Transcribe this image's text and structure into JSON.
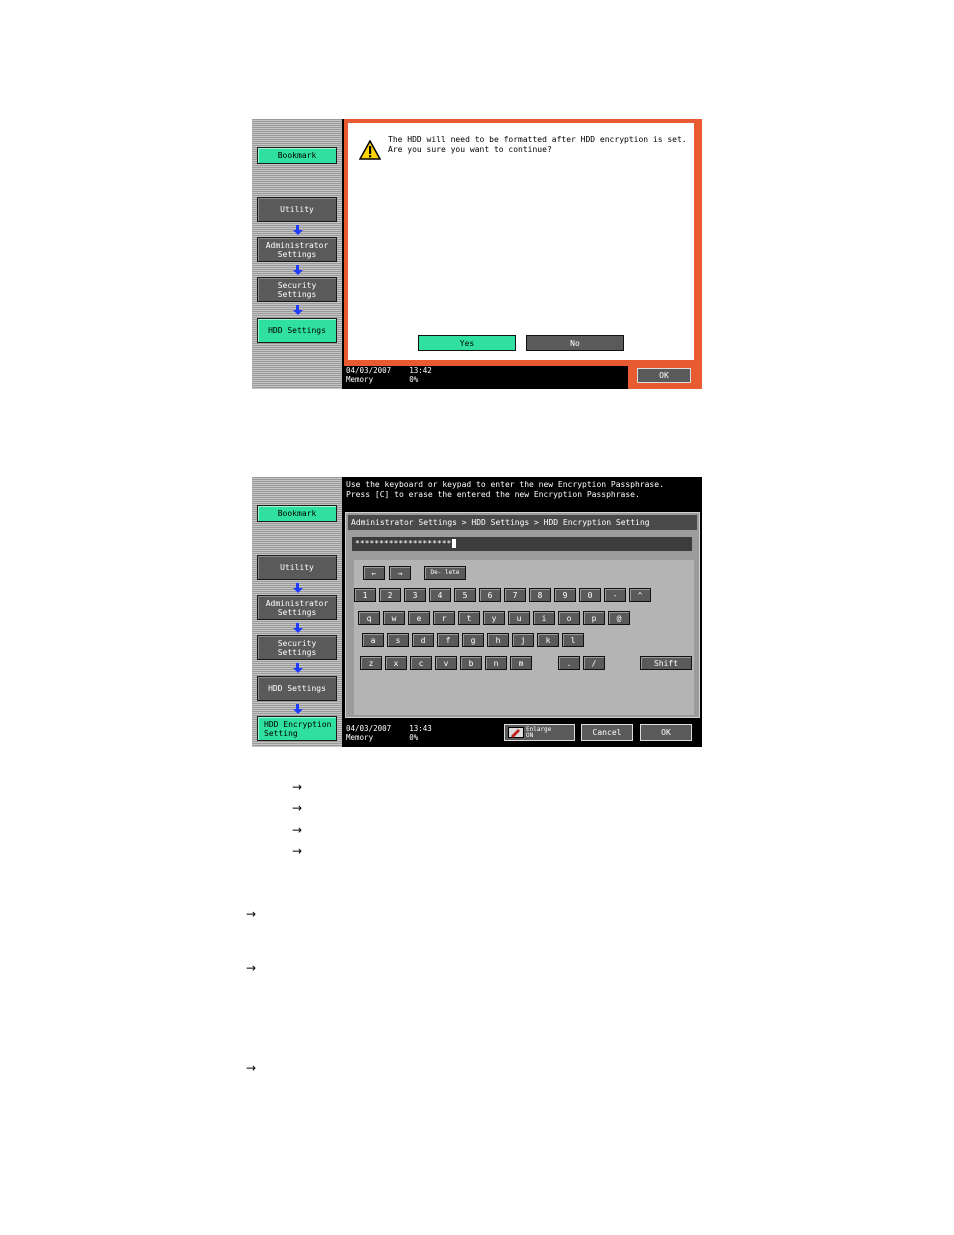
{
  "sidebar": {
    "bookmark": "Bookmark",
    "utility": "Utility",
    "administrator_settings": "Administrator Settings",
    "security_settings": "Security Settings",
    "hdd_settings": "HDD Settings",
    "hdd_encryption_setting": "HDD Encryption Setting"
  },
  "screen1": {
    "message_line1": "The HDD will need to be formatted after HDD encryption is set.",
    "message_line2": "Are you sure you want to continue?",
    "yes": "Yes",
    "no": "No",
    "ok": "OK",
    "status_date": "04/03/2007",
    "status_time": "13:42",
    "status_memory": "Memory",
    "status_percent": "0%"
  },
  "screen2": {
    "prompt_line1": "Use the keyboard or keypad to enter the new Encryption Passphrase.",
    "prompt_line2": "Press [C] to erase the entered the new Encryption Passphrase.",
    "breadcrumb": "Administrator Settings > HDD Settings > HDD Encryption Setting",
    "passphrase_value": "********************",
    "keys": {
      "left": "←",
      "right": "→",
      "delete": "De- lete",
      "row1": [
        "1",
        "2",
        "3",
        "4",
        "5",
        "6",
        "7",
        "8",
        "9",
        "0",
        "-",
        "^"
      ],
      "row2": [
        "q",
        "w",
        "e",
        "r",
        "t",
        "y",
        "u",
        "i",
        "o",
        "p",
        "@"
      ],
      "row3": [
        "a",
        "s",
        "d",
        "f",
        "g",
        "h",
        "j",
        "k",
        "l"
      ],
      "row4": [
        "z",
        "x",
        "c",
        "v",
        "b",
        "n",
        "m"
      ],
      "period": ".",
      "slash": "/",
      "shift": "Shift"
    },
    "enlarge": "Enlarge ON",
    "cancel": "Cancel",
    "ok": "OK",
    "status_date": "04/03/2007",
    "status_time": "13:43",
    "status_memory": "Memory",
    "status_percent": "0%"
  },
  "page_arrows": [
    "→",
    "→",
    "→",
    "→",
    "→",
    "→",
    "→"
  ]
}
